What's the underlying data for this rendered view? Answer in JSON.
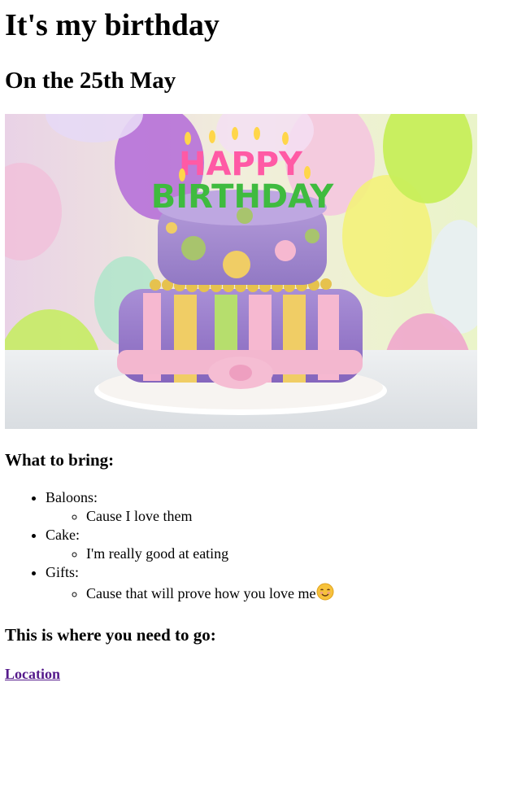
{
  "title": "It's my birthday",
  "subtitle": "On the 25th May",
  "image": {
    "icon": "birthday-cake-image",
    "cake_text_top": "HAPPY",
    "cake_text_bottom": "BIRTHDAY"
  },
  "bring": {
    "heading": "What to bring:",
    "items": [
      {
        "label": "Baloons:",
        "sub": "Cause I love them"
      },
      {
        "label": "Cake:",
        "sub": "I'm really good at eating"
      },
      {
        "label": "Gifts:",
        "sub": "Cause that will prove how you love me",
        "emoji": "smiling-face-emoji"
      }
    ]
  },
  "location": {
    "heading": "This is where you need to go:",
    "link_label": "Location"
  },
  "colors": {
    "link_visited": "#551a8b",
    "text": "#000000",
    "background": "#ffffff"
  }
}
